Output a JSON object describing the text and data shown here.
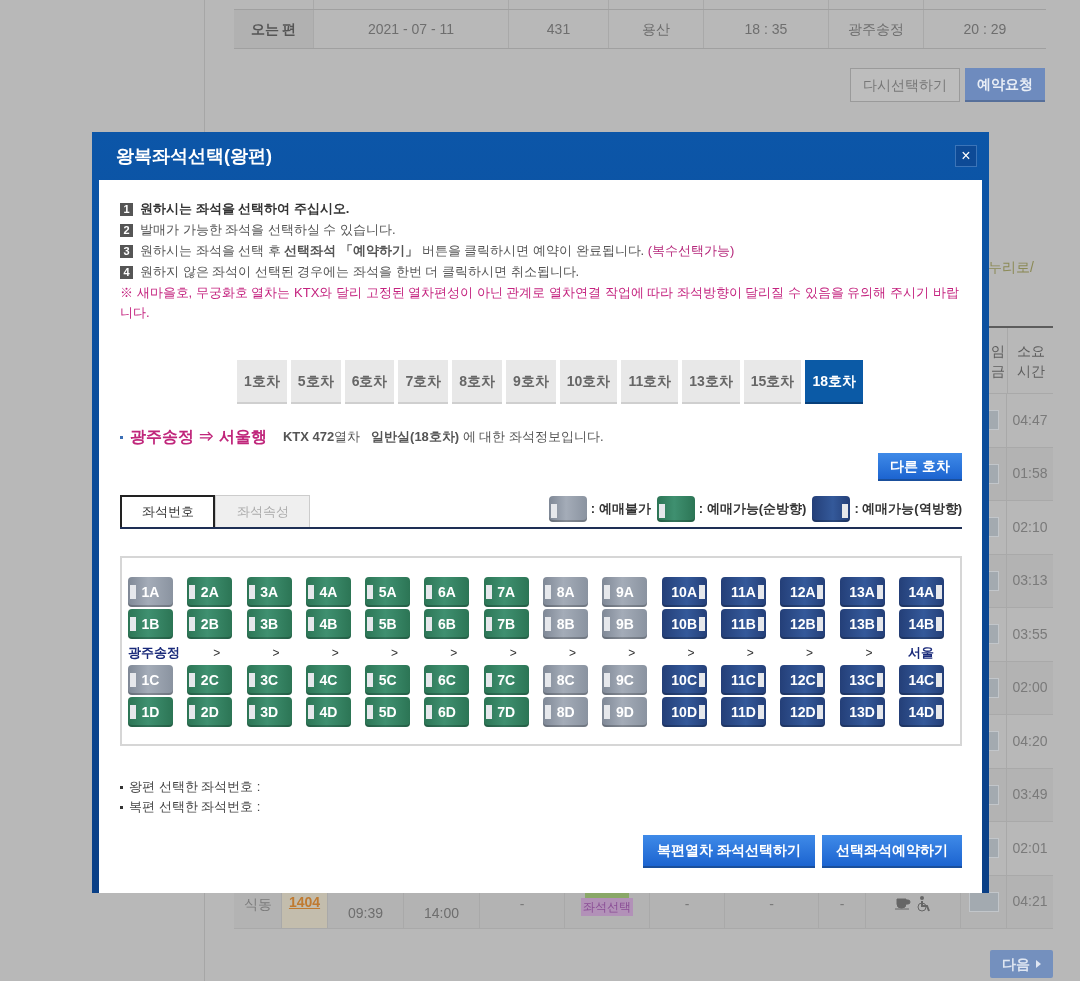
{
  "background_page": {
    "itinerary_row": [
      "오는 편",
      "2021 - 07 - 11",
      "431",
      "용산",
      "18 : 35",
      "광주송정",
      "20 : 29"
    ],
    "buttons": [
      {
        "label": "다시선택하기",
        "kind": "secondary"
      },
      {
        "label": "예약요청",
        "kind": "primary"
      }
    ],
    "train_type_text": "누리로/",
    "table": {
      "header": [
        {
          "lines": [
            "임",
            "금"
          ]
        },
        {
          "lines": [
            "소요",
            "시간"
          ]
        }
      ],
      "rows": [
        {
          "duration": "04:47"
        },
        {
          "duration": "01:58"
        },
        {
          "duration": "02:10"
        },
        {
          "duration": "03:13"
        },
        {
          "duration": "03:55"
        },
        {
          "duration": "02:00"
        },
        {
          "duration": "04:20"
        },
        {
          "duration": "03:49"
        },
        {
          "duration": "02:01"
        },
        {
          "duration": "04:21",
          "cells": [
            {
              "kind": "text",
              "text": "식동"
            },
            {
              "kind": "link",
              "text": "1404"
            },
            {
              "kind": "time",
              "text": "09:39"
            },
            {
              "kind": "time",
              "text": "14:00"
            },
            {
              "kind": "text",
              "text": "-"
            },
            {
              "kind": "badge",
              "text": "좌석선택"
            },
            {
              "kind": "text",
              "text": "-"
            },
            {
              "kind": "text",
              "text": "-"
            },
            {
              "kind": "text",
              "text": "-"
            },
            {
              "kind": "icons"
            }
          ]
        }
      ]
    },
    "next_button": "다음"
  },
  "modal": {
    "title": "왕복좌석선택(왕편)",
    "close": "×",
    "instructions": [
      {
        "number": "1",
        "text": "원하시는 좌석을 선택하여 주십시오.",
        "emphasis": true
      },
      {
        "number": "2",
        "text": "발매가 가능한 좌석을 선택하실 수 있습니다.",
        "emphasis": false
      },
      {
        "number": "3",
        "text": "원하시는 좌석을 선택 후 **선택좌석 「예약하기」** 버튼을 클릭하시면 예약이 완료됩니다.",
        "note": "(복수선택가능)",
        "emphasis": false
      },
      {
        "number": "4",
        "text": "원하지 않은 좌석이 선택된 경우에는 좌석을 한번 더 클릭하시면 취소됩니다.",
        "emphasis": false
      }
    ],
    "warning": "※ 새마을호, 무궁화호 열차는 KTX와 달리 고정된 열차편성이 아닌 관계로 열차연결 작업에 따라 좌석방향이 달리질 수 있음을 유의해 주시기 바랍니다.",
    "cars": [
      {
        "label": "1호차",
        "selected": false
      },
      {
        "label": "5호차",
        "selected": false
      },
      {
        "label": "6호차",
        "selected": false
      },
      {
        "label": "7호차",
        "selected": false
      },
      {
        "label": "8호차",
        "selected": false
      },
      {
        "label": "9호차",
        "selected": false
      },
      {
        "label": "10호차",
        "selected": false
      },
      {
        "label": "11호차",
        "selected": false
      },
      {
        "label": "13호차",
        "selected": false
      },
      {
        "label": "15호차",
        "selected": false
      },
      {
        "label": "18호차",
        "selected": true
      }
    ],
    "route": "광주송정 ⇒ 서울행",
    "train_info": "**KTX 472**열차   **일반실(18호차)** 에 대한 좌석정보입니다.",
    "other_car_button": "다른 호차",
    "view_tabs": [
      {
        "label": "좌석번호",
        "selected": true
      },
      {
        "label": "좌석속성",
        "selected": false
      }
    ],
    "legend": [
      {
        "kind": "unavailable",
        "label": ": 예매불가"
      },
      {
        "kind": "forward",
        "label": ": 예매가능(순방향)"
      },
      {
        "kind": "reverse",
        "label": ": 예매가능(역방향)"
      }
    ],
    "seat_rows_upper": [
      {
        "seats": [
          {
            "label": "1A",
            "kind": "unavailable"
          },
          {
            "label": "2A",
            "kind": "forward"
          },
          {
            "label": "3A",
            "kind": "forward"
          },
          {
            "label": "4A",
            "kind": "forward"
          },
          {
            "label": "5A",
            "kind": "forward"
          },
          {
            "label": "6A",
            "kind": "forward"
          },
          {
            "label": "7A",
            "kind": "forward"
          },
          {
            "label": "8A",
            "kind": "unavailable"
          },
          {
            "label": "9A",
            "kind": "unavailable"
          },
          {
            "label": "10A",
            "kind": "reverse"
          },
          {
            "label": "11A",
            "kind": "reverse"
          },
          {
            "label": "12A",
            "kind": "reverse"
          },
          {
            "label": "13A",
            "kind": "reverse"
          },
          {
            "label": "14A",
            "kind": "reverse"
          }
        ]
      },
      {
        "seats": [
          {
            "label": "1B",
            "kind": "forward"
          },
          {
            "label": "2B",
            "kind": "forward"
          },
          {
            "label": "3B",
            "kind": "forward"
          },
          {
            "label": "4B",
            "kind": "forward"
          },
          {
            "label": "5B",
            "kind": "forward"
          },
          {
            "label": "6B",
            "kind": "forward"
          },
          {
            "label": "7B",
            "kind": "forward"
          },
          {
            "label": "8B",
            "kind": "unavailable"
          },
          {
            "label": "9B",
            "kind": "unavailable"
          },
          {
            "label": "10B",
            "kind": "reverse"
          },
          {
            "label": "11B",
            "kind": "reverse"
          },
          {
            "label": "12B",
            "kind": "reverse"
          },
          {
            "label": "13B",
            "kind": "reverse"
          },
          {
            "label": "14B",
            "kind": "reverse"
          }
        ]
      }
    ],
    "direction_row": {
      "from": "광주송정",
      "arrows": [
        ">",
        ">",
        ">",
        ">",
        ">",
        ">",
        ">",
        ">",
        ">",
        ">",
        ">",
        ">"
      ],
      "to": "서울"
    },
    "seat_rows_lower": [
      {
        "seats": [
          {
            "label": "1C",
            "kind": "unavailable"
          },
          {
            "label": "2C",
            "kind": "forward"
          },
          {
            "label": "3C",
            "kind": "forward"
          },
          {
            "label": "4C",
            "kind": "forward"
          },
          {
            "label": "5C",
            "kind": "forward"
          },
          {
            "label": "6C",
            "kind": "forward"
          },
          {
            "label": "7C",
            "kind": "forward"
          },
          {
            "label": "8C",
            "kind": "unavailable"
          },
          {
            "label": "9C",
            "kind": "unavailable"
          },
          {
            "label": "10C",
            "kind": "reverse"
          },
          {
            "label": "11C",
            "kind": "reverse"
          },
          {
            "label": "12C",
            "kind": "reverse"
          },
          {
            "label": "13C",
            "kind": "reverse"
          },
          {
            "label": "14C",
            "kind": "reverse"
          }
        ]
      },
      {
        "seats": [
          {
            "label": "1D",
            "kind": "forward"
          },
          {
            "label": "2D",
            "kind": "forward"
          },
          {
            "label": "3D",
            "kind": "forward"
          },
          {
            "label": "4D",
            "kind": "forward"
          },
          {
            "label": "5D",
            "kind": "forward"
          },
          {
            "label": "6D",
            "kind": "forward"
          },
          {
            "label": "7D",
            "kind": "forward"
          },
          {
            "label": "8D",
            "kind": "unavailable"
          },
          {
            "label": "9D",
            "kind": "unavailable"
          },
          {
            "label": "10D",
            "kind": "reverse"
          },
          {
            "label": "11D",
            "kind": "reverse"
          },
          {
            "label": "12D",
            "kind": "reverse"
          },
          {
            "label": "13D",
            "kind": "reverse"
          },
          {
            "label": "14D",
            "kind": "reverse"
          }
        ]
      }
    ],
    "selected_seats": [
      "왕편 선택한 좌석번호 :",
      "복편 선택한 좌석번호 :"
    ],
    "actions": [
      "복편열차 좌석선택하기",
      "선택좌석예약하기"
    ]
  }
}
